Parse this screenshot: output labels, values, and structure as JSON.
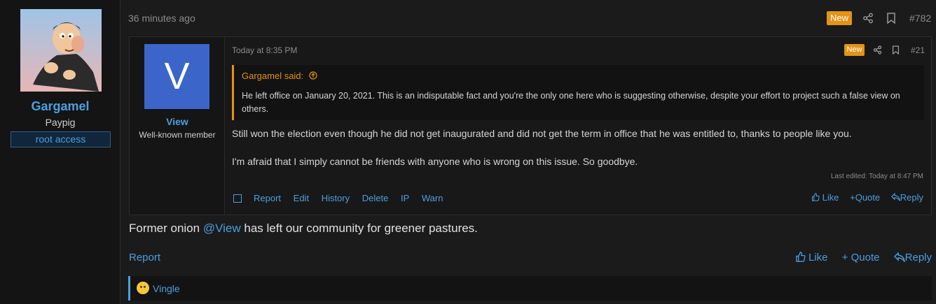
{
  "post": {
    "time": "36 minutes ago",
    "new_badge": "New",
    "number": "#782",
    "author": {
      "name": "Gargamel",
      "title": "Paypig",
      "banner": "root access"
    },
    "body_before": "Former onion ",
    "mention": "@View",
    "body_after": " has left our community for greener pastures.",
    "actions": {
      "report": "Report"
    },
    "reactions": {
      "like": "Like",
      "quote": "Quote",
      "reply": "Reply"
    },
    "reaction_bar": {
      "user": "Vingle"
    }
  },
  "quoted_post": {
    "time": "Today at 8:35 PM",
    "new_badge": "New",
    "number": "#21",
    "author": {
      "initial": "V",
      "name": "View",
      "title": "Well-known member"
    },
    "quote": {
      "attribution": "Gargamel said:",
      "text": "He left office on January 20, 2021. This is an indisputable fact and you're the only one here who is suggesting otherwise, despite your effort to project such a false view on others."
    },
    "body": [
      "Still won the election even though he did not get inaugurated and did not get the term in office that he was entitled to, thanks to people like you.",
      "I'm afraid that I simply cannot be friends with anyone who is wrong on this issue. So goodbye."
    ],
    "last_edited": "Last edited: Today at 8:47 PM",
    "actions": [
      "Report",
      "Edit",
      "History",
      "Delete",
      "IP",
      "Warn"
    ],
    "reactions": {
      "like": "Like",
      "quote": "Quote",
      "reply": "Reply"
    }
  },
  "colors": {
    "accent": "#4b9fe0",
    "new_badge": "#e39317",
    "background": "#1b1b1b"
  }
}
